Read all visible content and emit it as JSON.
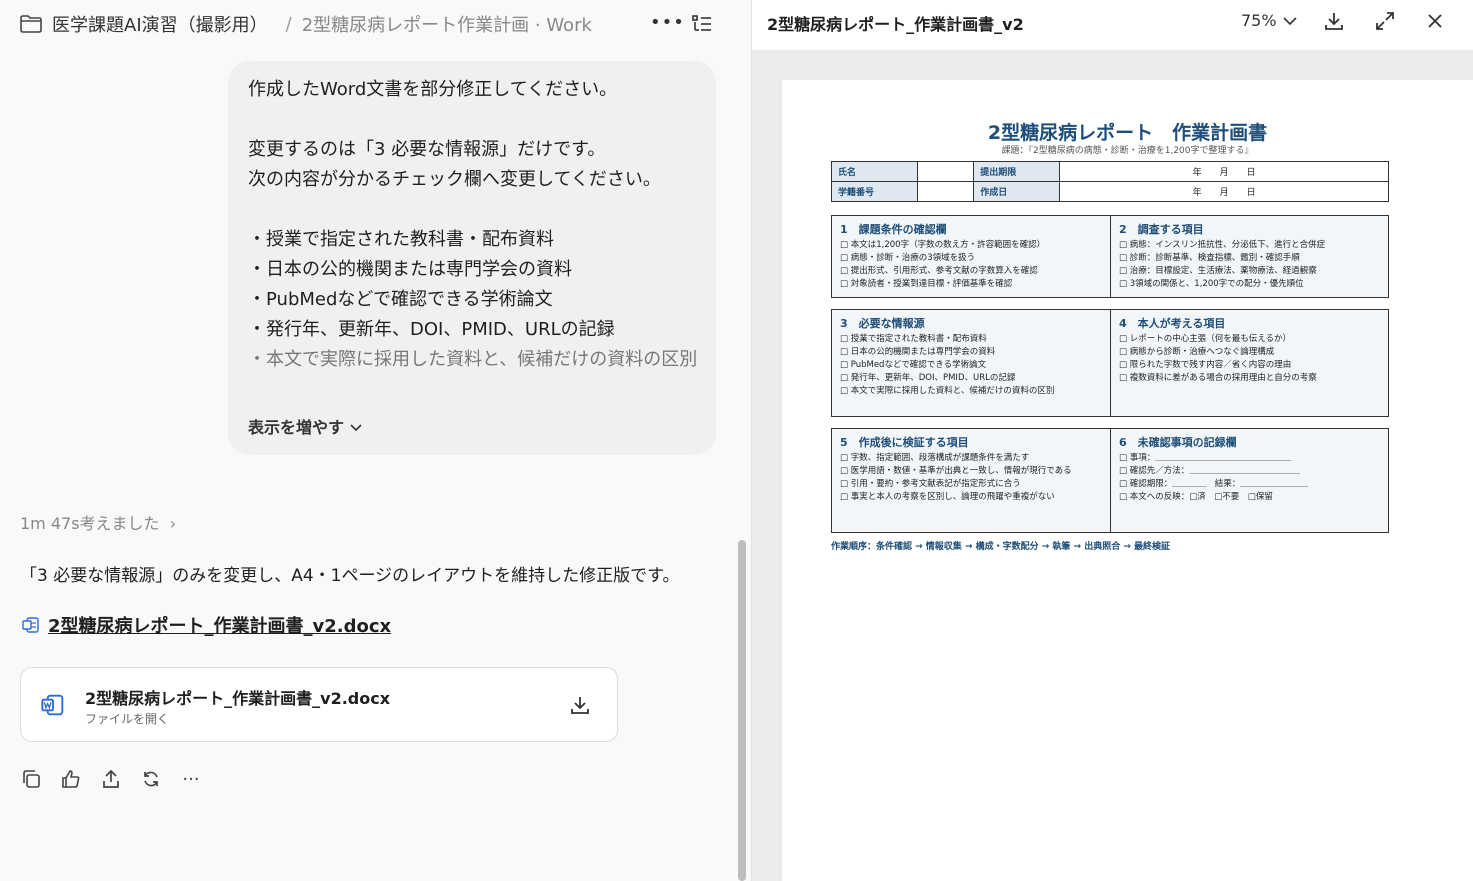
{
  "header": {
    "project": "医学課題AI演習（撮影用）",
    "separator": "/",
    "chat_title": "2型糖尿病レポート作業計画 · Work"
  },
  "message": {
    "lines": [
      "作成したWord文書を部分修正してください。",
      "",
      "変更するのは「3 必要な情報源」だけです。",
      "次の内容が分かるチェック欄へ変更してください。",
      "",
      "・授業で指定された教科書・配布資料",
      "・日本の公的機関または専門学会の資料",
      "・PubMedなどで確認できる学術論文",
      "・発行年、更新年、DOI、PMID、URLの記録",
      "・本文で実際に採用した資料と、候補だけの資料の区別"
    ],
    "show_more": "表示を増やす"
  },
  "response": {
    "thought": "1m 47s考えました",
    "text": "「3 必要な情報源」のみを変更し、A4・1ページのレイアウトを維持した修正版です。",
    "file_link": "2型糖尿病レポート_作業計画書_v2.docx",
    "card_name": "2型糖尿病レポート_作業計画書_v2.docx",
    "card_sub": "ファイルを開く"
  },
  "preview": {
    "title": "2型糖尿病レポート_作業計画書_v2",
    "zoom": "75%"
  },
  "doc": {
    "title": "2型糖尿病レポート　作業計画書",
    "subtitle": "課題：『2型糖尿病の病態・診断・治療を1,200字で整理する』",
    "name_label": "氏名",
    "due_label": "提出期限",
    "id_label": "学籍番号",
    "created_label": "作成日",
    "date_placeholder": "年　　月　　日",
    "sections": [
      {
        "left": {
          "title": "1　課題条件の確認欄",
          "items": [
            "□ 本文は1,200字（字数の数え方・許容範囲を確認）",
            "□ 病態・診断・治療の3領域を扱う",
            "□ 提出形式、引用形式、参考文献の字数算入を確認",
            "□ 対象読者・授業到達目標・評価基準を確認"
          ]
        },
        "right": {
          "title": "2　調査する項目",
          "items": [
            "□ 病態：インスリン抵抗性、分泌低下、進行と合併症",
            "□ 診断：診断基準、検査指標、鑑別・確認手順",
            "□ 治療：目標設定、生活療法、薬物療法、経過観察",
            "□ 3領域の関係と、1,200字での配分・優先順位"
          ]
        }
      },
      {
        "left": {
          "title": "3　必要な情報源",
          "items": [
            "□ 授業で指定された教科書・配布資料",
            "□ 日本の公的機関または専門学会の資料",
            "□ PubMedなどで確認できる学術論文",
            "□ 発行年、更新年、DOI、PMID、URLの記録",
            "□ 本文で実際に採用した資料と、候補だけの資料の区別"
          ]
        },
        "right": {
          "title": "4　本人が考える項目",
          "items": [
            "□ レポートの中心主張（何を最も伝えるか）",
            "□ 病態から診断・治療へつなぐ論理構成",
            "□ 限られた字数で残す内容／省く内容の理由",
            "□ 複数資料に差がある場合の採用理由と自分の考察"
          ]
        }
      },
      {
        "left": {
          "title": "5　作成後に検証する項目",
          "items": [
            "□ 字数、指定範囲、段落構成が課題条件を満たす",
            "□ 医学用語・数値・基準が出典と一致し、情報が現行である",
            "□ 引用・要約・参考文献表記が指定形式に合う",
            "□ 事実と本人の考察を区別し、論理の飛躍や重複がない"
          ]
        },
        "right": {
          "title": "6　未確認事項の記録欄",
          "items": [
            "□ 事項：＿＿＿＿＿＿＿＿＿＿＿＿＿＿＿＿",
            "□ 確認先／方法：＿＿＿＿＿＿＿＿＿＿＿＿＿",
            "□ 確認期限：＿＿＿＿　結果：＿＿＿＿＿＿＿＿",
            "□ 本文への反映：□済　□不要　□保留"
          ]
        }
      }
    ],
    "flow": "作業順序：条件確認 → 情報収集 → 構成・字数配分 → 執筆 → 出典照合 → 最終検証"
  }
}
